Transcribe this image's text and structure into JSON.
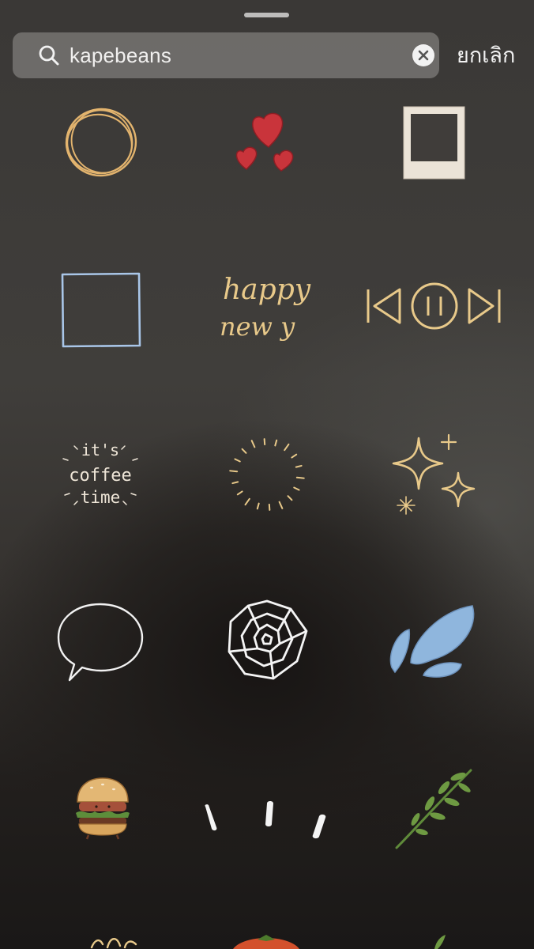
{
  "search": {
    "value": "kapebeans",
    "cancel_label": "ยกเลิก",
    "icon": "search-icon",
    "clear_icon": "clear-icon"
  },
  "stickers": {
    "coffee_time": [
      "it's",
      "coffee",
      "time"
    ],
    "happy_new_year": [
      "happy",
      "new y"
    ]
  },
  "colors": {
    "sheet_background": "#3a3836",
    "search_field": "#8c8a88",
    "gold_doodle": "#e8c98a",
    "heart_red": "#c9343b",
    "water_blue": "#8fb6dd",
    "leaf_green": "#5f8a3a"
  }
}
